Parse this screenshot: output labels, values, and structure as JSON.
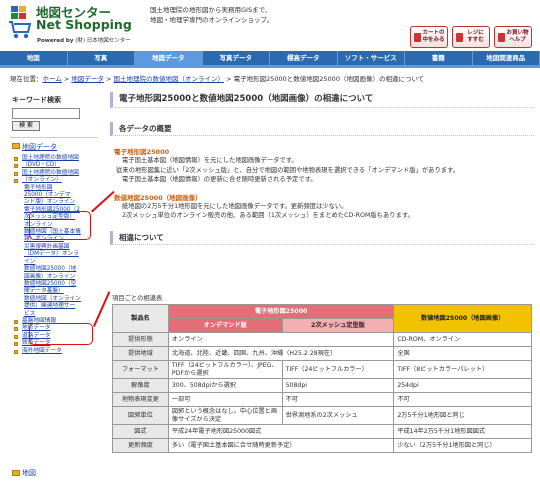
{
  "header": {
    "logo_line1": "地図センター",
    "logo_line2": "Net Shopping",
    "powered_by": "Powered by",
    "powered_org": "(財) 日本地図センター",
    "desc_line1": "国土地理院の地形図から実務用GISまで、",
    "desc_line2": "地図・地理学専門のオンラインショップ。",
    "buttons": [
      {
        "label1": "カートの",
        "label2": "中をみる"
      },
      {
        "label1": "レジに",
        "label2": "すすむ"
      },
      {
        "label1": "お買い物",
        "label2": "ヘルプ"
      }
    ]
  },
  "nav": {
    "items": [
      "地図",
      "写真",
      "地図データ",
      "写真データ",
      "標高データ",
      "ソフト・サービス",
      "書籍",
      "地図関連商品"
    ],
    "active_index": 2
  },
  "breadcrumb": {
    "prefix": "現在位置：",
    "items": [
      "ホーム",
      "地図データ",
      "国土地理院の数値地図（オンライン）"
    ],
    "current": "電子地形図25000と数値地図25000（地図画像）の相違について"
  },
  "sidebar": {
    "keyword_title": "キーワード検索",
    "search_button": "検 索",
    "section_title": "地図データ",
    "links": [
      {
        "text": "国土地理院の数値地図",
        "sub": false
      },
      {
        "text": "（DVD・CD）",
        "sub": false
      },
      {
        "text": "国土地理院の数値地図",
        "sub": false
      },
      {
        "text": "（オンライン）",
        "sub": false
      },
      {
        "text": "電子地形図",
        "sub": true
      },
      {
        "text": "25000（オンデマ",
        "sub": true
      },
      {
        "text": "ンド版）オンライン",
        "sub": true
      },
      {
        "text": "電子地形図25000（2",
        "sub": true
      },
      {
        "text": "次メッシュ定型版）",
        "sub": true
      },
      {
        "text": "オンライン",
        "sub": true
      },
      {
        "text": "数値地図（国土基本情",
        "sub": true
      },
      {
        "text": "報）オンライン",
        "sub": true
      },
      {
        "text": "災害復興計画基図",
        "sub": true
      },
      {
        "text": "（DMデータ）オンラ",
        "sub": true
      },
      {
        "text": "イン",
        "sub": true
      },
      {
        "text": "数値地図25000（地",
        "sub": true
      },
      {
        "text": "図画像）オンライン",
        "sub": true
      },
      {
        "text": "数値地図25000（空",
        "sub": true
      },
      {
        "text": "間データ基盤）",
        "sub": true
      },
      {
        "text": "数値地図（オンライン",
        "sub": true
      },
      {
        "text": "提供）関連地理サー",
        "sub": true
      },
      {
        "text": "ビス",
        "sub": true
      },
      {
        "text": "基盤地図情報",
        "sub": false
      },
      {
        "text": "地形データ",
        "sub": false
      },
      {
        "text": "道路データ",
        "sub": false
      },
      {
        "text": "鉄道データ",
        "sub": false
      },
      {
        "text": "海外地図データ",
        "sub": false
      }
    ],
    "footer_title": "地図"
  },
  "content": {
    "title": "電子地形図25000と数値地図25000（地図画像）の相違について",
    "section1_title": "各データの概要",
    "block1_title": "電子地形図25000",
    "block1_lines": [
      "電子国土基本図（地図情報）を元にした地図画像データです。",
      "従来の地形図集に近い「2次メッシュ版」と、自分で地図の範囲や地物表現を選択できる「オンデマンド版」があります。",
      "電子国土基本図（地図情報）の更新に合せ随時更新される予定です。"
    ],
    "block2_title": "数値地図25000（地図画像）",
    "block2_lines": [
      "紙地図の2万5千分1地形図を元にした地図画像データです。更新頻度は少ない。",
      "2次メッシュ単位のオンライン販売の他、ある範囲（1次メッシュ）をまとめたCD-ROM版もあります。"
    ],
    "section2_title": "相違について",
    "table_caption": "項目ごとの相違表"
  },
  "table": {
    "h_item": "製品名",
    "h_e": "電子地形図25000",
    "h_od": "オンデマンド版",
    "h_mesh": "2次メッシュ定型版",
    "h_nm": "数値地図25000（地図画像）",
    "rows": [
      {
        "label": "提供形態",
        "e": "オンライン",
        "e2": "",
        "n": "CD-ROM、オンライン",
        "split": false
      },
      {
        "label": "提供地域",
        "e": "北海道、北陸、近畿、四国、九州、沖縄（H25.2.28現在）",
        "e2": "",
        "n": "全国",
        "split": false
      },
      {
        "label": "フォーマット",
        "e": "TIFF（24ビットフルカラー）、JPEG、PDFから選択",
        "e2": "TIFF（24ビットフルカラー）",
        "n": "TIFF（8ビットカラーパレット）",
        "split": true
      },
      {
        "label": "解像度",
        "e": "300、508dpiから選択",
        "e2": "508dpi",
        "n": "254dpi",
        "split": true
      },
      {
        "label": "地物表現変更",
        "e": "一部可",
        "e2": "不可",
        "n": "不可",
        "split": true
      },
      {
        "label": "図郭単位",
        "e": "図郭という概念はなし。中心位置と画像サイズから決定",
        "e2": "世界測地系の2次メッシュ",
        "n": "2万5千分1地形図と同じ",
        "split": true
      },
      {
        "label": "図式",
        "e": "平成24年電子地形図25000図式",
        "e2": "",
        "n": "平成14年2万5千分1地形図図式",
        "split": false
      },
      {
        "label": "更新頻度",
        "e": "多い（電子国土基本図に合せ随時更新予定）",
        "e2": "",
        "n": "少ない（2万5千分1地形図と同じ）",
        "split": false
      }
    ]
  },
  "colors": {
    "nav_blue": "#2a6ab0",
    "nav_active": "#5a9ae0",
    "accent_orange": "#d06010",
    "header_red": "#e36e78",
    "header_yellow": "#f2c200",
    "annotation_red": "#e01010"
  }
}
